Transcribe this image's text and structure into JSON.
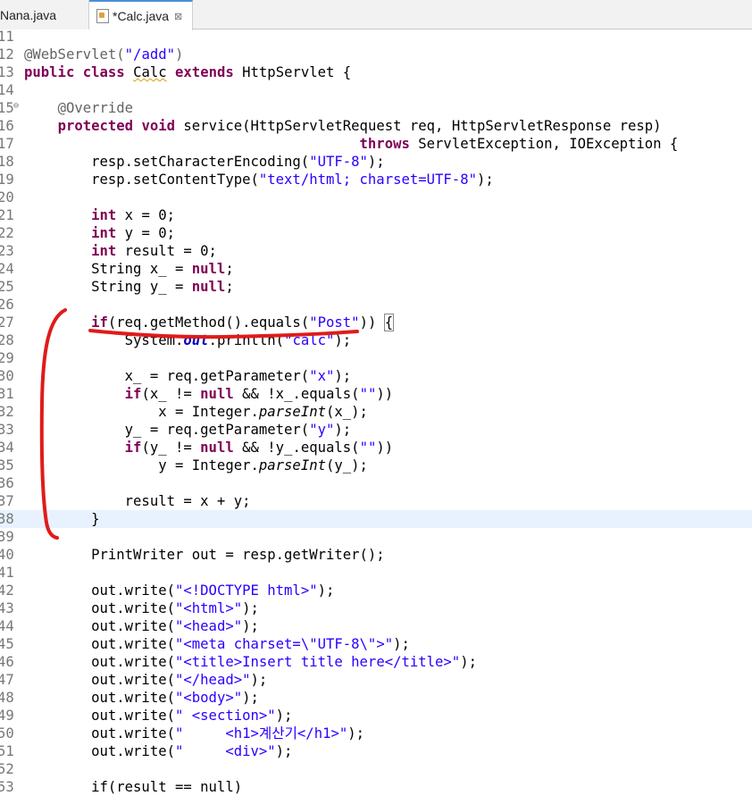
{
  "tabs": [
    {
      "label": "Nana.java",
      "active": false
    },
    {
      "label": "*Calc.java",
      "active": true,
      "close_glyph": "⊠"
    }
  ],
  "lines": [
    {
      "num": "11",
      "segs": []
    },
    {
      "num": "12",
      "segs": [
        {
          "t": "@WebServlet(",
          "c": "ann"
        },
        {
          "t": "\"/add\"",
          "c": "str"
        },
        {
          "t": ")",
          "c": "ann"
        }
      ]
    },
    {
      "num": "13",
      "segs": [
        {
          "t": "public",
          "c": "kw"
        },
        {
          "t": " "
        },
        {
          "t": "class",
          "c": "kw"
        },
        {
          "t": " "
        },
        {
          "t": "Calc",
          "c": "warn"
        },
        {
          "t": " "
        },
        {
          "t": "extends",
          "c": "kw"
        },
        {
          "t": " HttpServlet {"
        }
      ]
    },
    {
      "num": "14",
      "segs": []
    },
    {
      "num": "15",
      "marker": "⊖",
      "segs": [
        {
          "t": "    "
        },
        {
          "t": "@Override",
          "c": "ann"
        }
      ]
    },
    {
      "num": "16",
      "segs": [
        {
          "t": "    "
        },
        {
          "t": "protected",
          "c": "kw"
        },
        {
          "t": " "
        },
        {
          "t": "void",
          "c": "kw"
        },
        {
          "t": " service(HttpServletRequest req, HttpServletResponse resp)"
        }
      ]
    },
    {
      "num": "17",
      "segs": [
        {
          "t": "                                        "
        },
        {
          "t": "throws",
          "c": "kw"
        },
        {
          "t": " ServletException, IOException {"
        }
      ]
    },
    {
      "num": "18",
      "segs": [
        {
          "t": "        resp.setCharacterEncoding("
        },
        {
          "t": "\"UTF-8\"",
          "c": "str"
        },
        {
          "t": ");"
        }
      ]
    },
    {
      "num": "19",
      "segs": [
        {
          "t": "        resp.setContentType("
        },
        {
          "t": "\"text/html; charset=UTF-8\"",
          "c": "str"
        },
        {
          "t": ");"
        }
      ]
    },
    {
      "num": "20",
      "segs": []
    },
    {
      "num": "21",
      "segs": [
        {
          "t": "        "
        },
        {
          "t": "int",
          "c": "kw"
        },
        {
          "t": " x = 0;"
        }
      ]
    },
    {
      "num": "22",
      "segs": [
        {
          "t": "        "
        },
        {
          "t": "int",
          "c": "kw"
        },
        {
          "t": " y = 0;"
        }
      ]
    },
    {
      "num": "23",
      "segs": [
        {
          "t": "        "
        },
        {
          "t": "int",
          "c": "kw"
        },
        {
          "t": " result = 0;"
        }
      ]
    },
    {
      "num": "24",
      "segs": [
        {
          "t": "        String x_ = "
        },
        {
          "t": "null",
          "c": "kw"
        },
        {
          "t": ";"
        }
      ]
    },
    {
      "num": "25",
      "segs": [
        {
          "t": "        String y_ = "
        },
        {
          "t": "null",
          "c": "kw"
        },
        {
          "t": ";"
        }
      ]
    },
    {
      "num": "26",
      "segs": []
    },
    {
      "num": "27",
      "segs": [
        {
          "t": "        "
        },
        {
          "t": "if",
          "c": "kw"
        },
        {
          "t": "(req.getMethod().equals("
        },
        {
          "t": "\"Post\"",
          "c": "str"
        },
        {
          "t": ")) "
        },
        {
          "t": "{",
          "c": "bracket"
        }
      ]
    },
    {
      "num": "28",
      "segs": [
        {
          "t": "            System."
        },
        {
          "t": "out",
          "c": "boldit"
        },
        {
          "t": ".println("
        },
        {
          "t": "\"calc\"",
          "c": "str"
        },
        {
          "t": ");"
        }
      ]
    },
    {
      "num": "29",
      "segs": []
    },
    {
      "num": "30",
      "segs": [
        {
          "t": "            x_ = req.getParameter("
        },
        {
          "t": "\"x\"",
          "c": "str"
        },
        {
          "t": ");"
        }
      ]
    },
    {
      "num": "31",
      "segs": [
        {
          "t": "            "
        },
        {
          "t": "if",
          "c": "kw"
        },
        {
          "t": "(x_ != "
        },
        {
          "t": "null",
          "c": "kw"
        },
        {
          "t": " && !x_.equals("
        },
        {
          "t": "\"\"",
          "c": "str"
        },
        {
          "t": "))"
        }
      ]
    },
    {
      "num": "32",
      "segs": [
        {
          "t": "                x = Integer."
        },
        {
          "t": "parseInt",
          "c": "ital"
        },
        {
          "t": "(x_);"
        }
      ]
    },
    {
      "num": "33",
      "segs": [
        {
          "t": "            y_ = req.getParameter("
        },
        {
          "t": "\"y\"",
          "c": "str"
        },
        {
          "t": ");"
        }
      ]
    },
    {
      "num": "34",
      "segs": [
        {
          "t": "            "
        },
        {
          "t": "if",
          "c": "kw"
        },
        {
          "t": "(y_ != "
        },
        {
          "t": "null",
          "c": "kw"
        },
        {
          "t": " && !y_.equals("
        },
        {
          "t": "\"\"",
          "c": "str"
        },
        {
          "t": "))"
        }
      ]
    },
    {
      "num": "35",
      "segs": [
        {
          "t": "                y = Integer."
        },
        {
          "t": "parseInt",
          "c": "ital"
        },
        {
          "t": "(y_);"
        }
      ]
    },
    {
      "num": "36",
      "segs": []
    },
    {
      "num": "37",
      "segs": [
        {
          "t": "            result = x + y;"
        }
      ]
    },
    {
      "num": "38",
      "hl": true,
      "segs": [
        {
          "t": "        }"
        }
      ]
    },
    {
      "num": "39",
      "segs": []
    },
    {
      "num": "40",
      "segs": [
        {
          "t": "        PrintWriter out = resp.getWriter();"
        }
      ]
    },
    {
      "num": "41",
      "segs": []
    },
    {
      "num": "42",
      "segs": [
        {
          "t": "        out.write("
        },
        {
          "t": "\"<!DOCTYPE html>\"",
          "c": "str"
        },
        {
          "t": ");"
        }
      ]
    },
    {
      "num": "43",
      "segs": [
        {
          "t": "        out.write("
        },
        {
          "t": "\"<html>\"",
          "c": "str"
        },
        {
          "t": ");"
        }
      ]
    },
    {
      "num": "44",
      "segs": [
        {
          "t": "        out.write("
        },
        {
          "t": "\"<head>\"",
          "c": "str"
        },
        {
          "t": ");"
        }
      ]
    },
    {
      "num": "45",
      "segs": [
        {
          "t": "        out.write("
        },
        {
          "t": "\"<meta charset=\\\"UTF-8\\\">\"",
          "c": "str"
        },
        {
          "t": ");"
        }
      ]
    },
    {
      "num": "46",
      "segs": [
        {
          "t": "        out.write("
        },
        {
          "t": "\"<title>Insert title here</title>\"",
          "c": "str"
        },
        {
          "t": ");"
        }
      ]
    },
    {
      "num": "47",
      "segs": [
        {
          "t": "        out.write("
        },
        {
          "t": "\"</head>\"",
          "c": "str"
        },
        {
          "t": ");"
        }
      ]
    },
    {
      "num": "48",
      "segs": [
        {
          "t": "        out.write("
        },
        {
          "t": "\"<body>\"",
          "c": "str"
        },
        {
          "t": ");"
        }
      ]
    },
    {
      "num": "49",
      "segs": [
        {
          "t": "        out.write("
        },
        {
          "t": "\" <section>\"",
          "c": "str"
        },
        {
          "t": ");"
        }
      ]
    },
    {
      "num": "50",
      "segs": [
        {
          "t": "        out.write("
        },
        {
          "t": "\"     <h1>계산기</h1>\"",
          "c": "str"
        },
        {
          "t": ");"
        }
      ]
    },
    {
      "num": "51",
      "segs": [
        {
          "t": "        out.write("
        },
        {
          "t": "\"     <div>\"",
          "c": "str"
        },
        {
          "t": ");"
        }
      ]
    },
    {
      "num": "52",
      "segs": []
    },
    {
      "num": "53",
      "segs": [
        {
          "t": "        if(result == null)"
        }
      ]
    }
  ]
}
